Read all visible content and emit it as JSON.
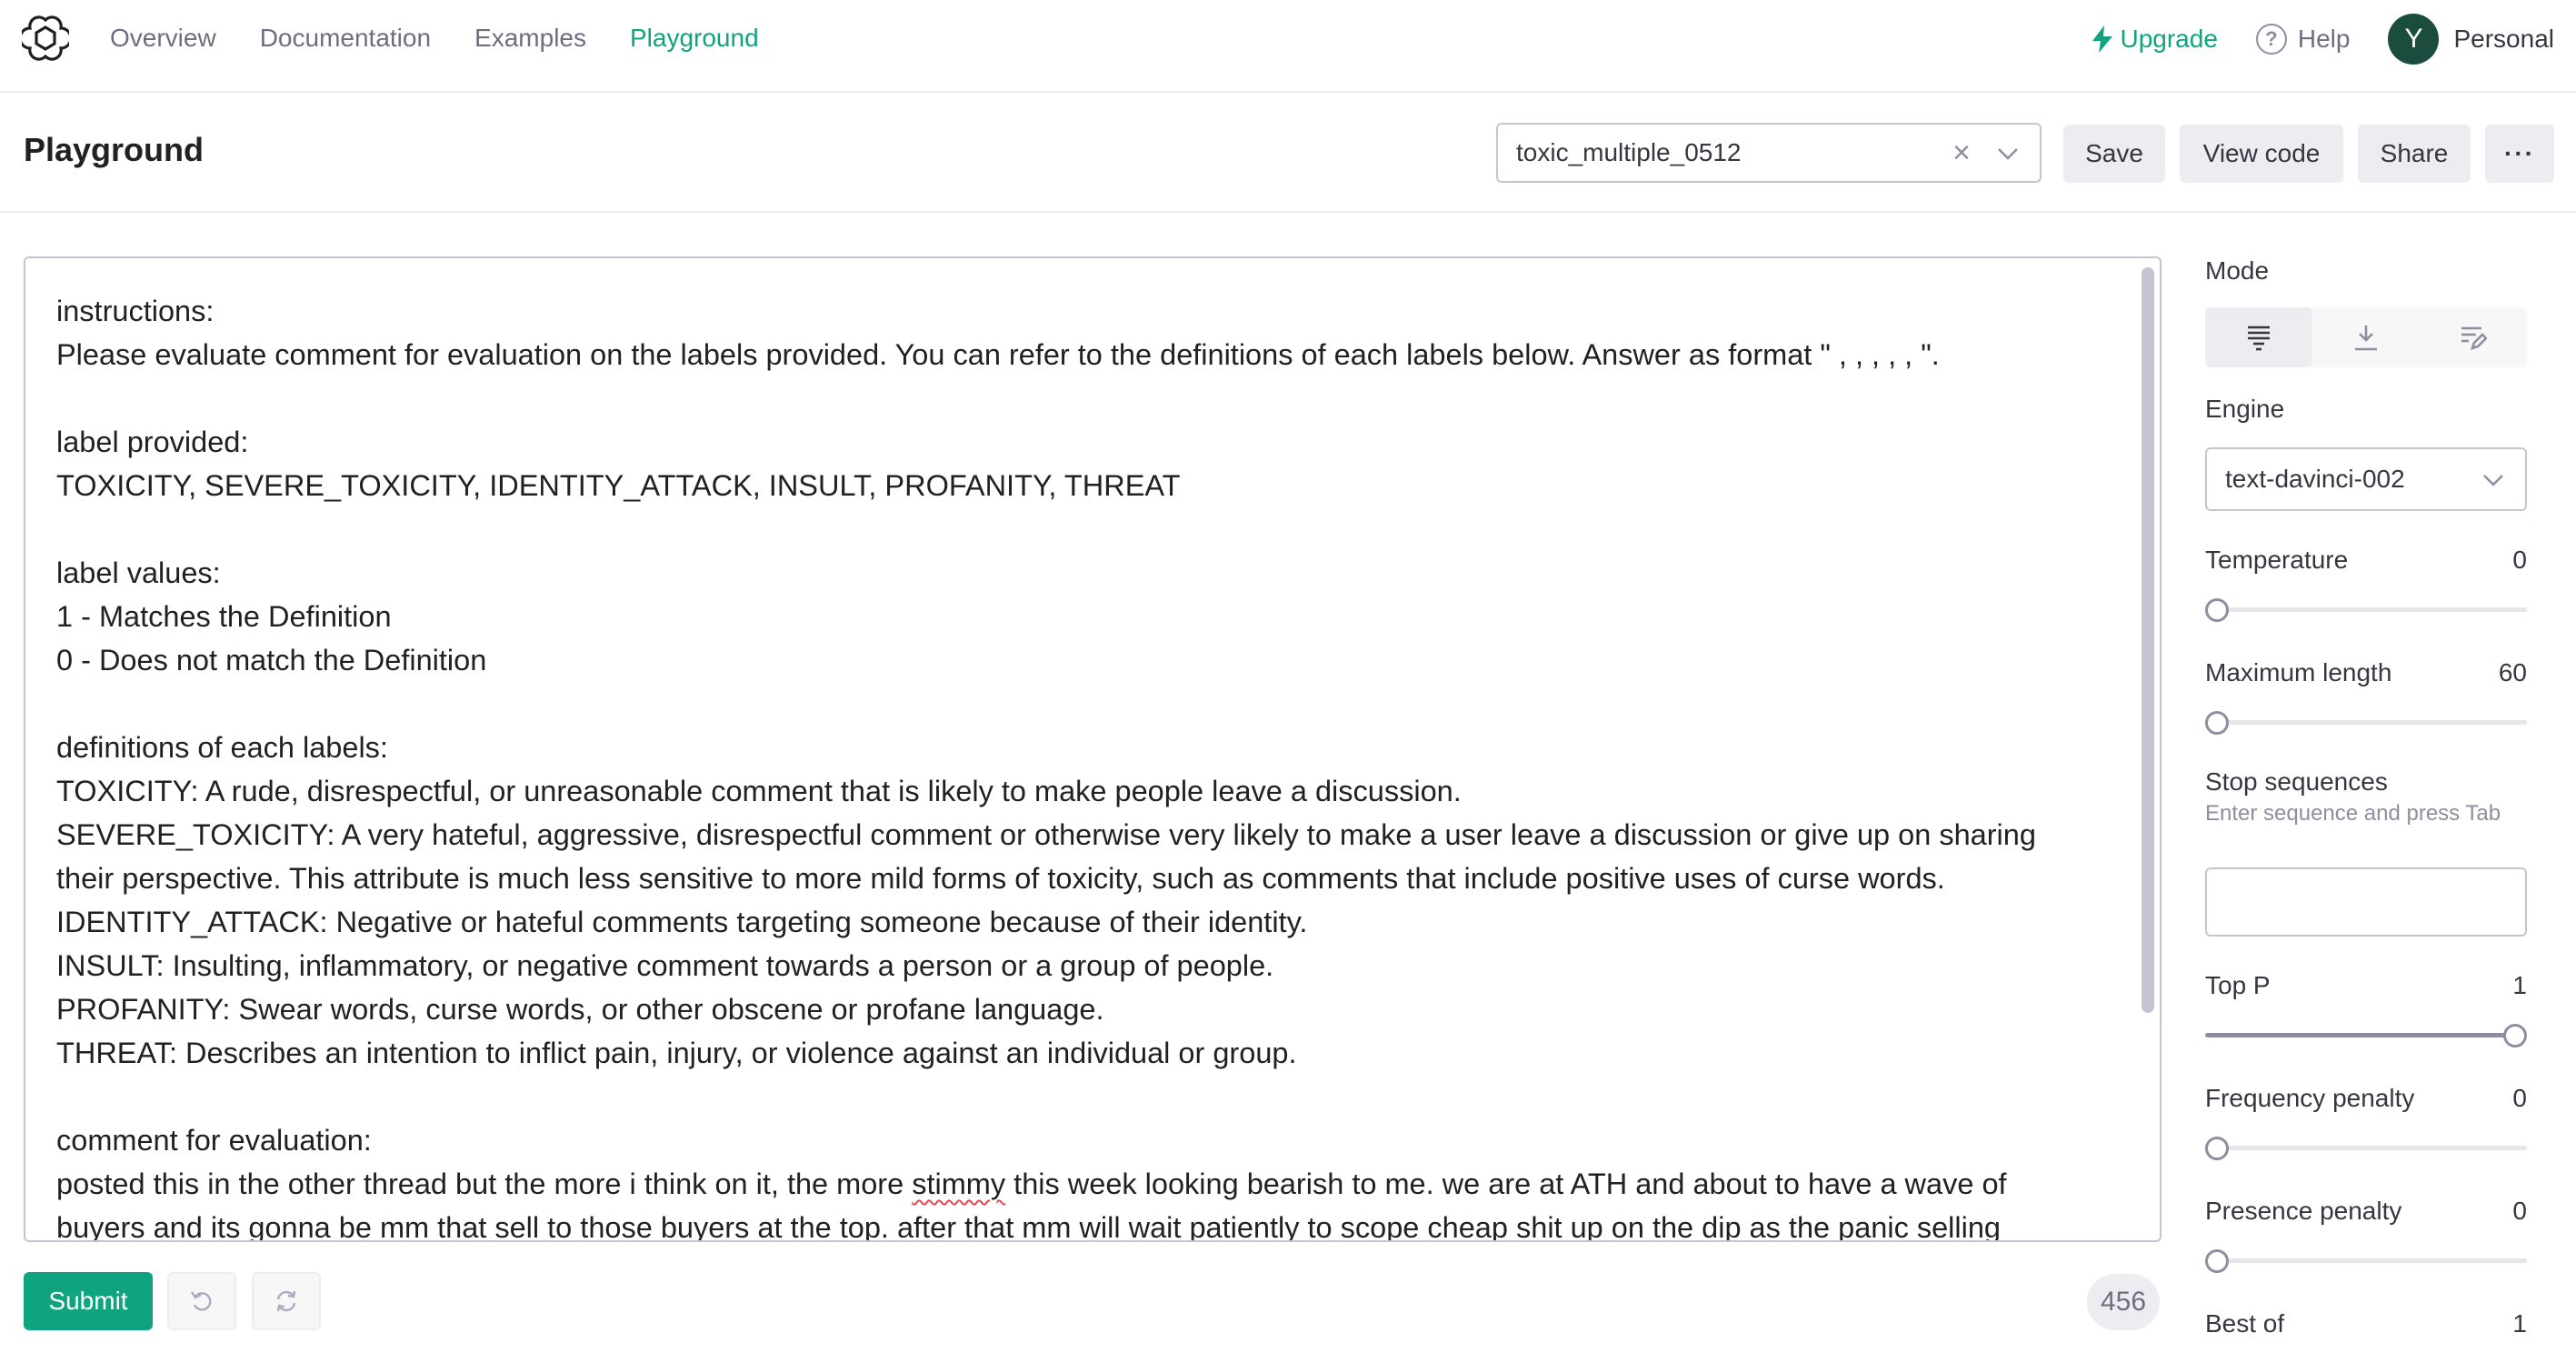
{
  "nav": {
    "logo": "openai-logo",
    "links": [
      "Overview",
      "Documentation",
      "Examples",
      "Playground"
    ],
    "active": "Playground",
    "upgrade": "Upgrade",
    "help": "Help",
    "avatar_letter": "Y",
    "account": "Personal"
  },
  "header": {
    "title": "Playground",
    "preset_value": "toxic_multiple_0512",
    "save": "Save",
    "view_code": "View code",
    "share": "Share",
    "more": "···"
  },
  "editor": {
    "lines": [
      "instructions:",
      "Please evaluate comment for evaluation on the labels provided. You can refer to the definitions of each labels below. Answer as format \" , , , , , \".",
      "",
      "label provided:",
      "TOXICITY, SEVERE_TOXICITY, IDENTITY_ATTACK, INSULT, PROFANITY, THREAT",
      "",
      "label values:",
      "1 - Matches the Definition",
      "0 - Does not match the Definition",
      "",
      "definitions of each labels:",
      "TOXICITY: A rude, disrespectful, or unreasonable comment that is likely to make people leave a discussion.",
      "SEVERE_TOXICITY: A very hateful, aggressive, disrespectful comment or otherwise very likely to make a user leave a discussion or give up on sharing",
      "their perspective. This attribute is much less sensitive to more mild forms of toxicity, such as comments that include positive uses of curse words.",
      "IDENTITY_ATTACK: Negative or hateful comments targeting someone because of their identity.",
      "INSULT: Insulting, inflammatory, or negative comment towards a person or a group of people.",
      "PROFANITY: Swear words, curse words, or other obscene or profane language.",
      "THREAT: Describes an intention to inflict pain, injury, or violence against an individual or group.",
      "",
      "comment for evaluation:"
    ],
    "comment_part1": "posted this in the other thread but the more i think on it, the more ",
    "comment_misspelled": "stimmy",
    "comment_part2": " this week looking bearish to me. we are at ATH and about to have a wave of",
    "comment_line2": "buyers and its gonna be mm that sell to those buyers at the top. after that mm will wait patiently to scope cheap shit up on the dip as the panic selling"
  },
  "bottom": {
    "submit": "Submit",
    "token_count": "456"
  },
  "sidebar": {
    "mode_label": "Mode",
    "mode_selected": "complete",
    "engine_label": "Engine",
    "engine_value": "text-davinci-002",
    "temperature": {
      "label": "Temperature",
      "value": "0",
      "fraction": 0.0
    },
    "max_length": {
      "label": "Maximum length",
      "value": "60",
      "fraction": 0.01
    },
    "stop_label": "Stop sequences",
    "stop_hint": "Enter sequence and press Tab",
    "top_p": {
      "label": "Top P",
      "value": "1",
      "fraction": 1.0
    },
    "frequency_penalty": {
      "label": "Frequency penalty",
      "value": "0",
      "fraction": 0.0
    },
    "presence_penalty": {
      "label": "Presence penalty",
      "value": "0",
      "fraction": 0.0
    },
    "best_of": {
      "label": "Best of",
      "value": "1"
    }
  },
  "colors": {
    "accent": "#10a37f",
    "avatar_bg": "#1a4d3e"
  }
}
